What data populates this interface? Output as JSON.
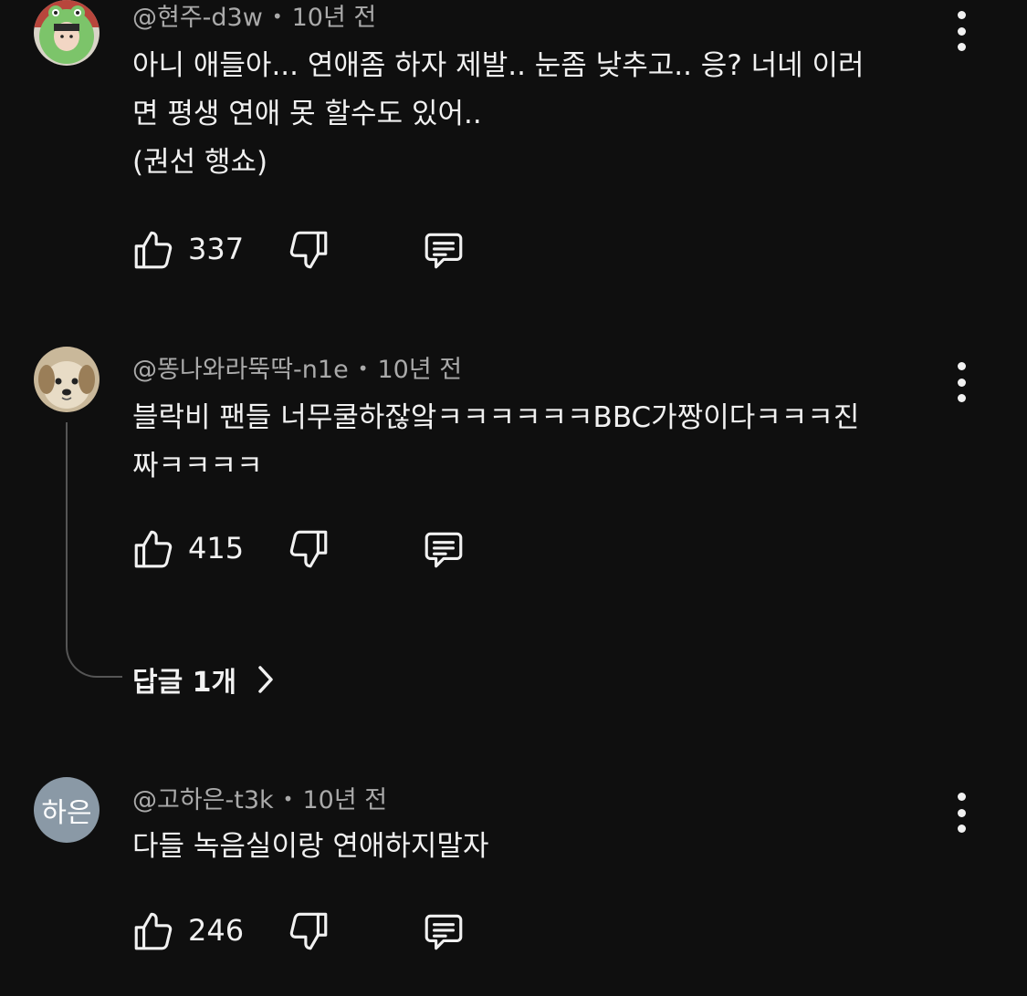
{
  "comments": [
    {
      "author": "@현주-d3w",
      "time": "10년 전",
      "lines": [
        "아니 애들아... 연애좀 하자 제발.. 눈좀 낮추고.. 응? 너네 이러",
        "면 평생 연애 못 할수도 있어..",
        "(권선 행쇼)"
      ],
      "likes": "337",
      "avatar_icon": "frog-costume-avatar"
    },
    {
      "author": "@똥나와라뚝딱-n1e",
      "time": "10년 전",
      "lines": [
        "블락비 팬들 너무쿨하잖앜ㅋㅋㅋㅋㅋㅋBBC가짱이다ㅋㅋㅋ진",
        "짜ㅋㅋㅋㅋ"
      ],
      "likes": "415",
      "avatar_icon": "puppy-avatar",
      "replies_label": "답글 1개"
    },
    {
      "author": "@고하은-t3k",
      "time": "10년 전",
      "lines": [
        "다들 녹음실이랑 연애하지말자"
      ],
      "likes": "246",
      "avatar_initials": "하은",
      "avatar_color": "#8a99a6"
    }
  ],
  "icons": {
    "like": "thumbs-up-icon",
    "dislike": "thumbs-down-icon",
    "reply": "comment-reply-icon",
    "more": "more-vert-icon",
    "chevron": "chevron-right-icon"
  },
  "colors": {
    "background": "#0f0f0f",
    "text": "#f1f1f1",
    "meta": "#aaaaaa",
    "thread_line": "#555555"
  }
}
